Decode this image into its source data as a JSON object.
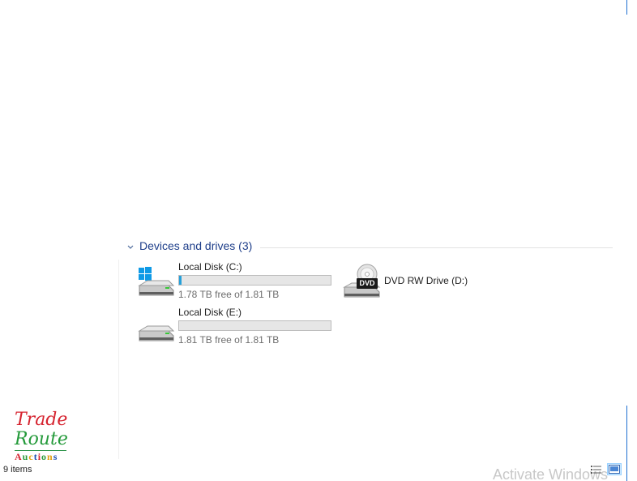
{
  "group": {
    "title": "Devices and drives (3)",
    "chevron_icon": "chevron-down-icon"
  },
  "drives": [
    {
      "name": "Local Disk (C:)",
      "free_text": "1.78 TB free of 1.81 TB",
      "used_fraction": 0.017,
      "icon": "windows-drive-icon"
    },
    {
      "name": "DVD RW Drive (D:)",
      "icon": "dvd-drive-icon",
      "icon_label": "DVD"
    },
    {
      "name": "Local Disk (E:)",
      "free_text": "1.81 TB free of 1.81 TB",
      "used_fraction": 0.0,
      "icon": "hard-drive-icon"
    }
  ],
  "status_bar": {
    "item_count": "9 items",
    "watermark": "Activate Windows",
    "view_buttons": [
      {
        "name": "details-view-icon",
        "active": false
      },
      {
        "name": "large-icons-view-icon",
        "active": true
      }
    ]
  },
  "logo": {
    "line1": "Trade",
    "line2": "Route",
    "line3_letters": [
      "A",
      "u",
      "c",
      "t",
      "i",
      "o",
      "n",
      "s"
    ],
    "line3_colors": [
      "#d62430",
      "#2a9b3b",
      "#e0a010",
      "#1c4fb0",
      "#d62430",
      "#2a9b3b",
      "#e0a010",
      "#1c4fb0"
    ]
  },
  "colors": {
    "accent": "#26a0da",
    "group_title": "#1e3e8a",
    "window_border": "#1f6fd1"
  }
}
